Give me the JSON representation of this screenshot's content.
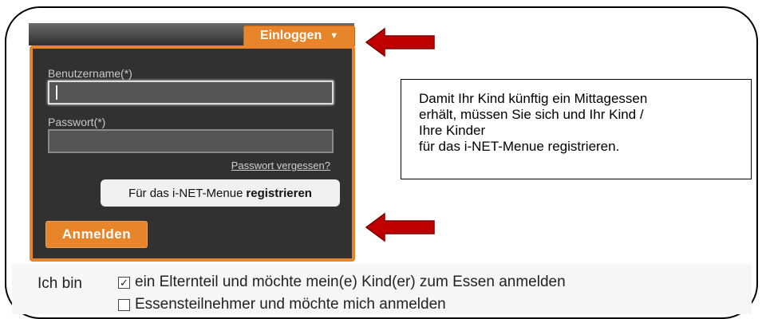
{
  "login": {
    "tab_label": "Einloggen",
    "tab_caret": "▼",
    "username_label": "Benutzername(*)",
    "username_value": "",
    "password_label": "Passwort(*)",
    "password_value": "",
    "forgot_link": "Passwort vergessen?",
    "register_prefix": "Für das i-NET-Menue",
    "register_bold": "registrieren",
    "submit_label": "Anmelden"
  },
  "note": {
    "lines": [
      "Damit Ihr Kind künftig ein Mittagessen",
      "erhält, müssen Sie sich und Ihr Kind /",
      "Ihre Kinder",
      "für das i-NET-Menue registrieren."
    ]
  },
  "choice": {
    "prefix": "Ich bin",
    "options": [
      {
        "label": "ein Elternteil und möchte mein(e) Kind(er) zum Essen anmelden",
        "checked": true
      },
      {
        "label": "Essensteilnehmer und möchte mich anmelden",
        "checked": false
      }
    ]
  },
  "colors": {
    "accent": "#e8842a",
    "panel": "#313131",
    "arrow": "#c00000"
  }
}
